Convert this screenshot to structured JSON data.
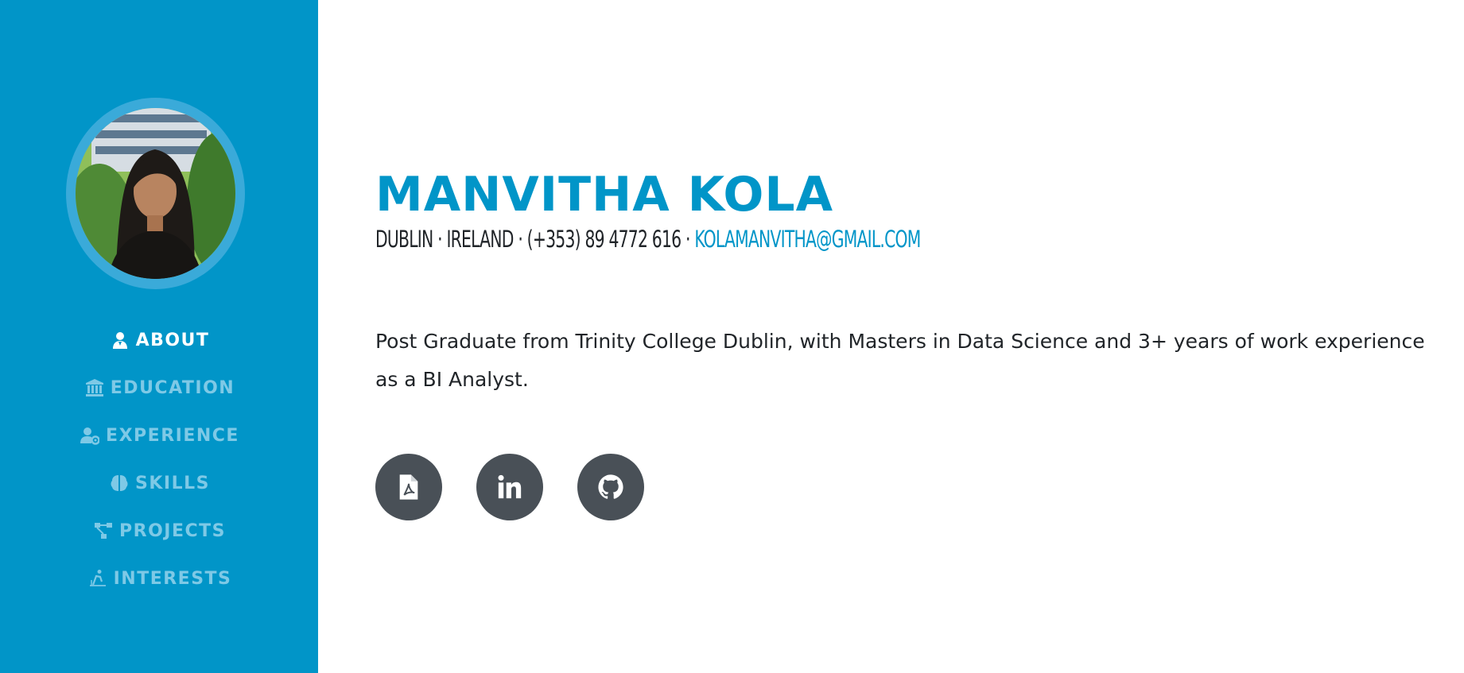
{
  "profile": {
    "photo_alt": "Profile photo"
  },
  "nav": {
    "items": [
      {
        "label": "ABOUT",
        "icon": "user-icon",
        "active": true
      },
      {
        "label": "EDUCATION",
        "icon": "university-icon",
        "active": false
      },
      {
        "label": "EXPERIENCE",
        "icon": "user-cog-icon",
        "active": false
      },
      {
        "label": "SKILLS",
        "icon": "brain-icon",
        "active": false
      },
      {
        "label": "PROJECTS",
        "icon": "project-diagram-icon",
        "active": false
      },
      {
        "label": "INTERESTS",
        "icon": "skiing-icon",
        "active": false
      }
    ]
  },
  "header": {
    "name": "MANVITHA KOLA",
    "location": "DUBLIN · IRELAND · (+353) 89 4772 616 · ",
    "email": "KOLAMANVITHA@GMAIL.COM"
  },
  "about": {
    "bio": "Post Graduate from Trinity College Dublin, with Masters in Data Science and 3+ years of work experience as a BI Analyst."
  },
  "social": [
    {
      "name": "resume-pdf",
      "icon": "file-pdf-icon"
    },
    {
      "name": "linkedin",
      "icon": "linkedin-icon"
    },
    {
      "name": "github",
      "icon": "github-icon"
    }
  ],
  "colors": {
    "accent": "#0195c8",
    "sidebar_inactive": "#7ec9e6",
    "social_bg": "#495057",
    "text": "#212529"
  }
}
